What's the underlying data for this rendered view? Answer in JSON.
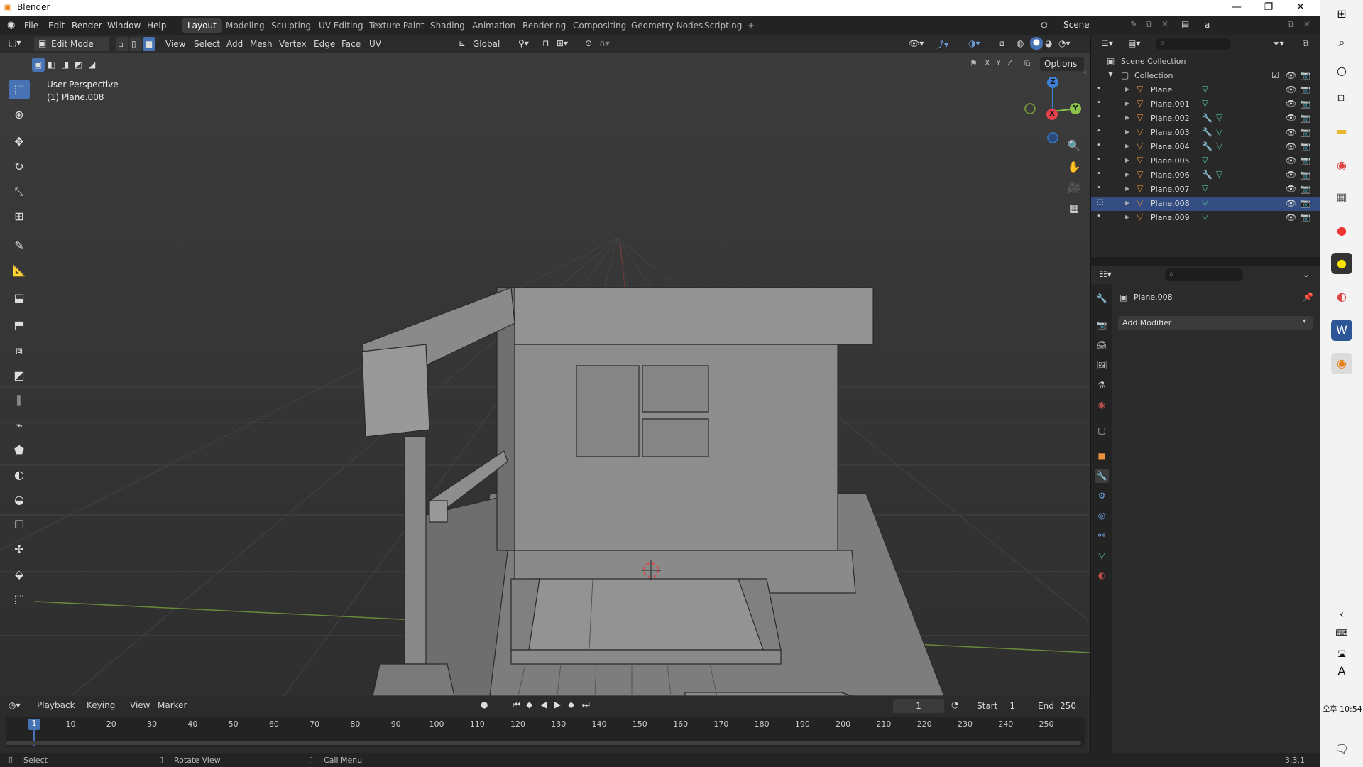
{
  "window": {
    "title": "Blender",
    "version": "3.3.1"
  },
  "menu": [
    "File",
    "Edit",
    "Render",
    "Window",
    "Help"
  ],
  "workspaces": [
    {
      "label": "Layout",
      "active": true
    },
    {
      "label": "Modeling"
    },
    {
      "label": "Sculpting"
    },
    {
      "label": "UV Editing"
    },
    {
      "label": "Texture Paint"
    },
    {
      "label": "Shading"
    },
    {
      "label": "Animation"
    },
    {
      "label": "Rendering"
    },
    {
      "label": "Compositing"
    },
    {
      "label": "Geometry Nodes"
    },
    {
      "label": "Scripting"
    }
  ],
  "add_workspace": "+",
  "scene": {
    "label": "Scene",
    "viewlayer": "a"
  },
  "viewport_header": {
    "mode": "Edit Mode",
    "menus": [
      "View",
      "Select",
      "Add",
      "Mesh",
      "Vertex",
      "Edge",
      "Face",
      "UV"
    ],
    "transform": "Global",
    "options": "Options",
    "axes": [
      "X",
      "Y",
      "Z"
    ]
  },
  "viewport_info": {
    "line1": "User Perspective",
    "line2": "(1) Plane.008"
  },
  "gizmo": {
    "z": "Z",
    "y": "Y",
    "x": "X"
  },
  "timeline": {
    "menus": [
      "Playback",
      "Keying",
      "View",
      "Marker"
    ],
    "current_frame": "1",
    "start_label": "Start",
    "start": "1",
    "end_label": "End",
    "end": "250",
    "ticks": [
      "1",
      "10",
      "20",
      "30",
      "40",
      "50",
      "60",
      "70",
      "80",
      "90",
      "100",
      "110",
      "120",
      "130",
      "140",
      "150",
      "160",
      "170",
      "180",
      "190",
      "200",
      "210",
      "220",
      "230",
      "240",
      "250"
    ]
  },
  "status": {
    "select": "Select",
    "rotate": "Rotate View",
    "menu": "Call Menu"
  },
  "outliner": {
    "scene_collection": "Scene Collection",
    "collection": "Collection",
    "objects": [
      {
        "name": "Plane",
        "modifier": false
      },
      {
        "name": "Plane.001",
        "modifier": false
      },
      {
        "name": "Plane.002",
        "modifier": true
      },
      {
        "name": "Plane.003",
        "modifier": true
      },
      {
        "name": "Plane.004",
        "modifier": true
      },
      {
        "name": "Plane.005",
        "modifier": false
      },
      {
        "name": "Plane.006",
        "modifier": true
      },
      {
        "name": "Plane.007",
        "modifier": false
      },
      {
        "name": "Plane.008",
        "modifier": false,
        "selected": true
      },
      {
        "name": "Plane.009",
        "modifier": false
      }
    ]
  },
  "properties": {
    "object": "Plane.008",
    "add_modifier": "Add Modifier"
  },
  "taskbar": {
    "time": "오후 10:54",
    "ime": "A"
  },
  "colors": {
    "accent": "#4772b3",
    "selected_row": "#334d80",
    "x_axis": "#e6404d",
    "y_axis": "#8bc34a",
    "z_axis": "#3d7fd6"
  }
}
